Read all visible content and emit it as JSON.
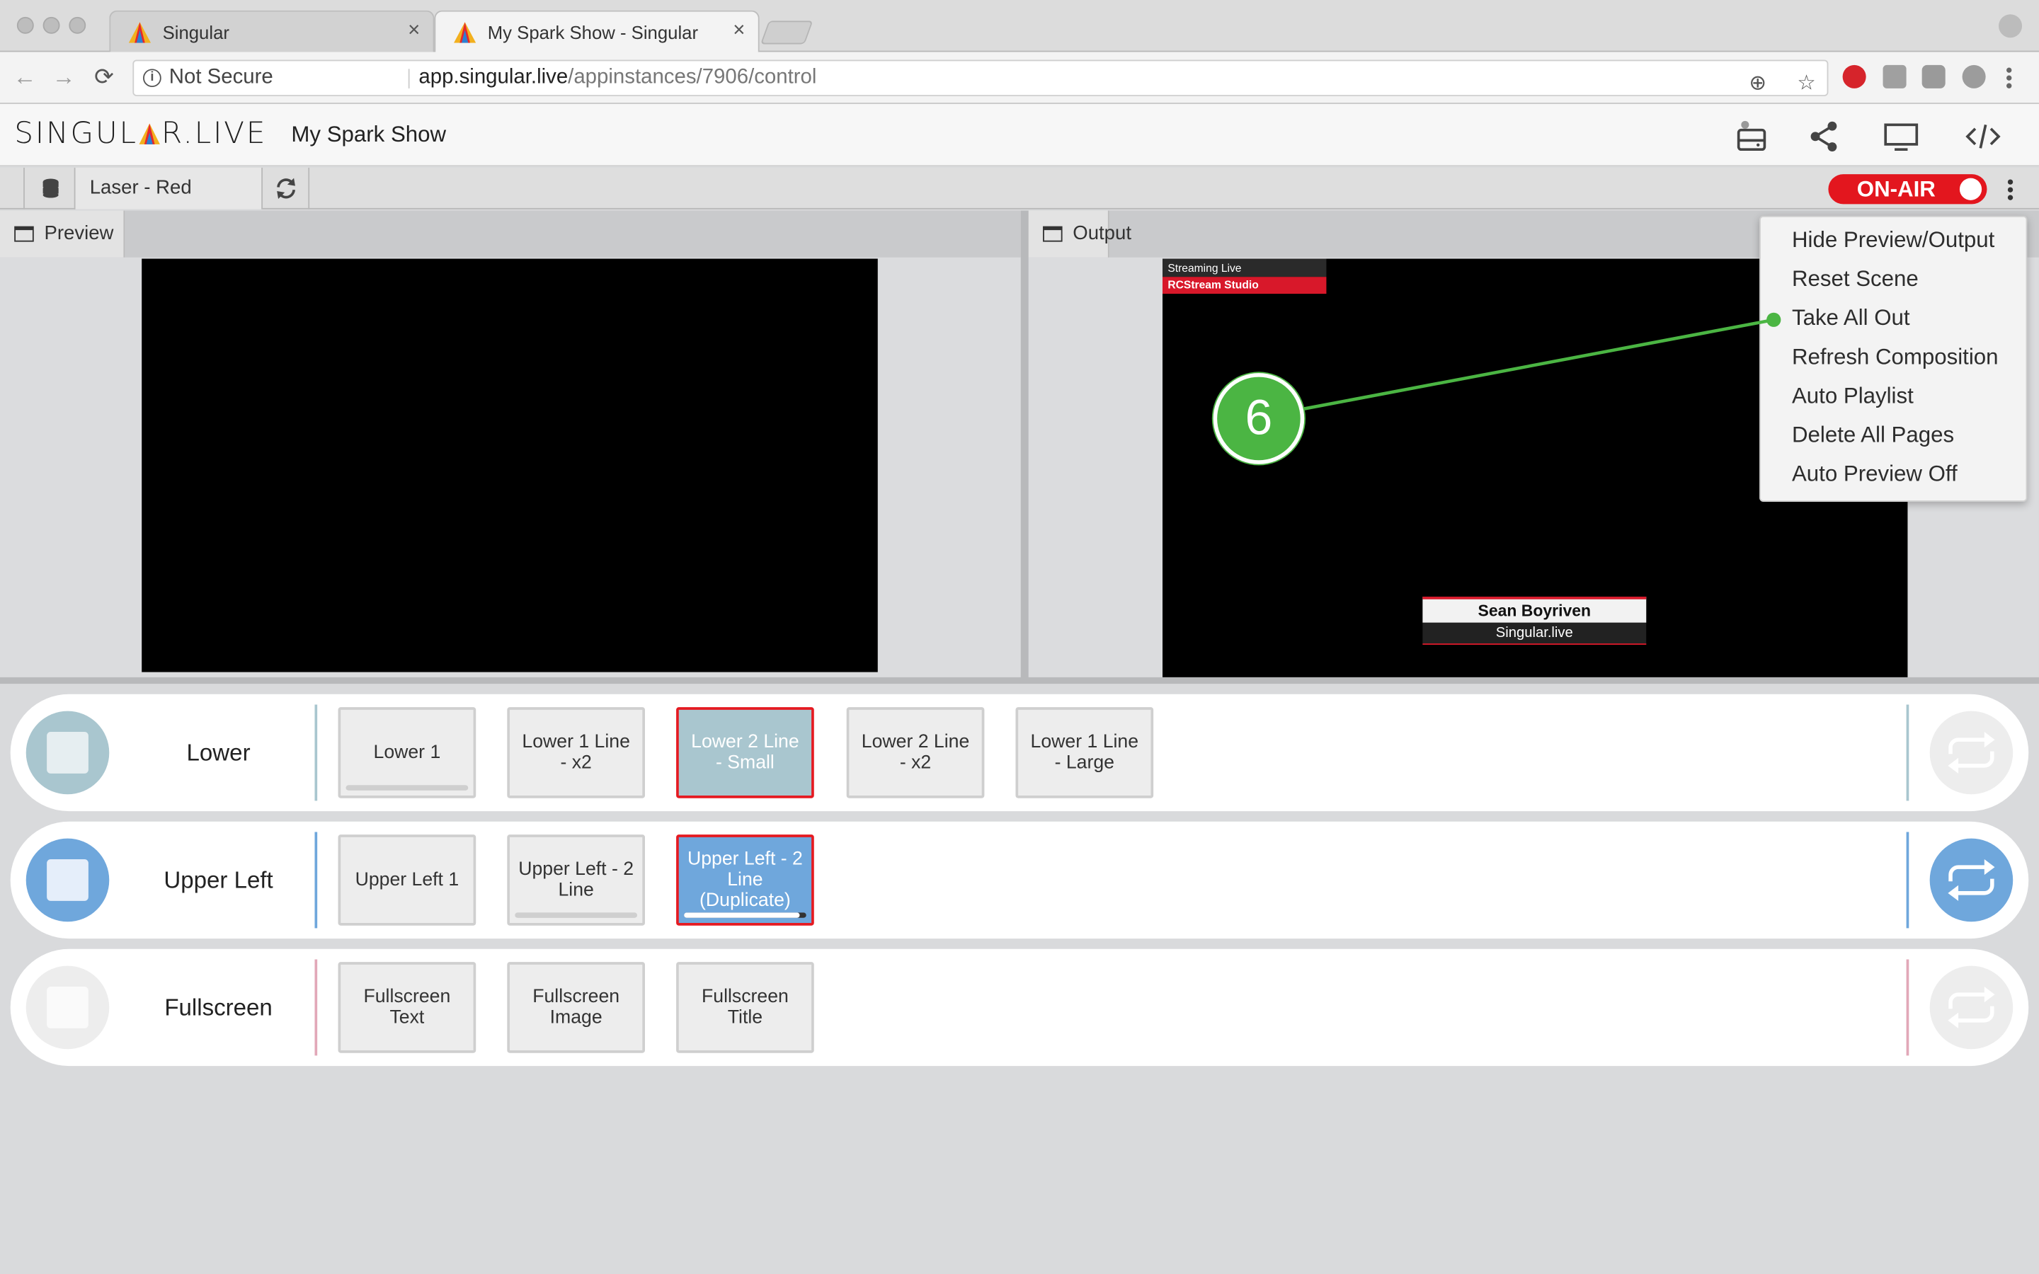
{
  "browser": {
    "tabs": [
      {
        "title": "Singular",
        "close": "×",
        "active": false
      },
      {
        "title": "My Spark Show - Singular",
        "close": "×",
        "active": true
      }
    ],
    "security": "Not Secure",
    "url_host": "app.singular.live",
    "url_path": "/appinstances/7906/control",
    "nav": {
      "back": "←",
      "forward": "→",
      "reload": "⟳"
    },
    "omni_icons": {
      "zoom": "⊕",
      "star": "☆"
    }
  },
  "app": {
    "logo_left": "SINGUL",
    "logo_right": "R.LIVE",
    "show_name": "My Spark Show",
    "header_icons": [
      "storage-icon",
      "share-icon",
      "monitor-icon",
      "code-icon"
    ]
  },
  "controlbar": {
    "composition": "Laser - Red",
    "on_air_label": "ON-AIR",
    "on_air": true
  },
  "panes": {
    "preview_label": "Preview",
    "output_label": "Output"
  },
  "output_graphics": {
    "top_line1": "Streaming Live",
    "top_line2": "RCStream Studio",
    "lower_name": "Sean Boyriven",
    "lower_org": "Singular.live"
  },
  "menu": {
    "items": [
      "Hide Preview/Output",
      "Reset Scene",
      "Take All Out",
      "Refresh Composition",
      "Auto Playlist",
      "Delete All Pages",
      "Auto Preview Off"
    ],
    "highlighted_index": 2
  },
  "annotation": {
    "number": "6"
  },
  "layers": [
    {
      "name": "Lower",
      "accent": "#a9c6cf",
      "active": false,
      "buttons": [
        {
          "label": "Lower 1",
          "selected": false,
          "progress": 1.0
        },
        {
          "label": "Lower 1 Line - x2",
          "selected": false
        },
        {
          "label": "Lower 2 Line - Small",
          "selected": true,
          "color": "#a9c6cf"
        },
        {
          "label": "Lower 2 Line - x2",
          "selected": false
        },
        {
          "label": "Lower 1 Line - Large",
          "selected": false
        }
      ]
    },
    {
      "name": "Upper Left",
      "accent": "#6fa7dc",
      "active": true,
      "buttons": [
        {
          "label": "Upper Left 1",
          "selected": false
        },
        {
          "label": "Upper Left - 2 Line",
          "selected": false,
          "progress": 1.0
        },
        {
          "label": "Upper Left - 2 Line (Duplicate)",
          "selected": true,
          "color": "#6fa7dc",
          "progress": 0.95
        }
      ]
    },
    {
      "name": "Fullscreen",
      "accent": "#e2a8b8",
      "active": false,
      "buttons": [
        {
          "label": "Fullscreen Text",
          "selected": false
        },
        {
          "label": "Fullscreen Image",
          "selected": false
        },
        {
          "label": "Fullscreen Title",
          "selected": false
        }
      ]
    }
  ],
  "colors": {
    "on_air": "#e3161e",
    "selected_border": "#e51a21",
    "callout": "#4bb543"
  }
}
